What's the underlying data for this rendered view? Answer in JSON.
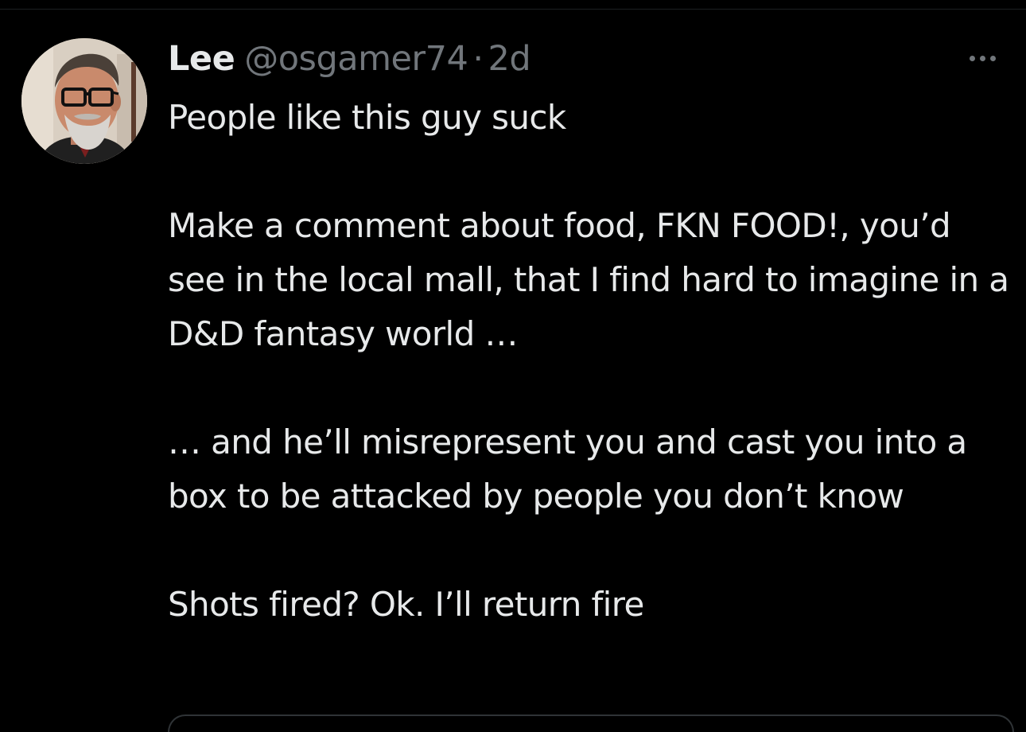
{
  "tweet": {
    "author": {
      "display_name": "Lee",
      "handle": "@osgamer74"
    },
    "separator": "·",
    "timestamp": "2d",
    "more_icon": "more-horizontal-icon",
    "paragraphs": [
      "People like this guy suck",
      "Make a comment about food, FKN FOOD!, you’d see in the local mall, that I find hard to imagine in a D&D fantasy world …",
      "… and he’ll misrepresent you and cast you into a box to be attacked by people you don’t know",
      "Shots fired? Ok. I’ll return fire"
    ]
  },
  "colors": {
    "background": "#000000",
    "text_primary": "#e7e9ea",
    "text_secondary": "#71767b",
    "border": "#2f3336"
  }
}
